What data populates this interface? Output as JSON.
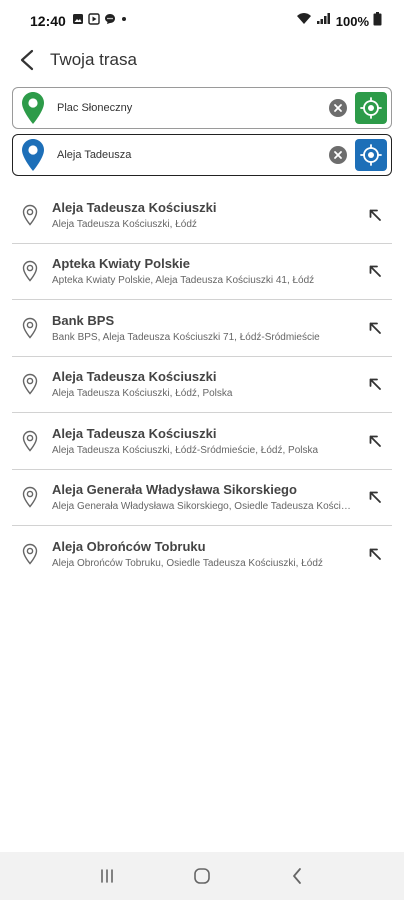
{
  "status_bar": {
    "time": "12:40",
    "battery": "100%",
    "icons": [
      "gallery-icon",
      "play-icon",
      "chat-icon",
      "dot-icon",
      "wifi-icon",
      "signal-icon",
      "battery-icon"
    ]
  },
  "header": {
    "title": "Twoja trasa"
  },
  "route": {
    "from": {
      "value": "Plac Słoneczny",
      "pin_color": "#2d9b49"
    },
    "to": {
      "value": "Aleja Tadeusza",
      "pin_color": "#1d6fb8"
    }
  },
  "results": [
    {
      "title": "Aleja Tadeusza Kościuszki",
      "subtitle": "Aleja Tadeusza Kościuszki, Łódź"
    },
    {
      "title": "Apteka Kwiaty Polskie",
      "subtitle": "Apteka Kwiaty Polskie, Aleja Tadeusza Kościuszki 41, Łódź"
    },
    {
      "title": "Bank BPS",
      "subtitle": "Bank BPS, Aleja Tadeusza Kościuszki 71, Łódź-Śródmieście"
    },
    {
      "title": "Aleja Tadeusza Kościuszki",
      "subtitle": "Aleja Tadeusza Kościuszki, Łódź, Polska"
    },
    {
      "title": "Aleja Tadeusza Kościuszki",
      "subtitle": "Aleja Tadeusza Kościuszki, Łódź-Śródmieście, Łódź, Polska"
    },
    {
      "title": "Aleja Generała Władysława Sikorskiego",
      "subtitle": "Aleja Generała Władysława Sikorskiego, Osiedle Tadeusza Kościuszki"
    },
    {
      "title": "Aleja Obrońców Tobruku",
      "subtitle": "Aleja Obrońców Tobruku, Osiedle Tadeusza Kościuszki, Łódź"
    }
  ]
}
